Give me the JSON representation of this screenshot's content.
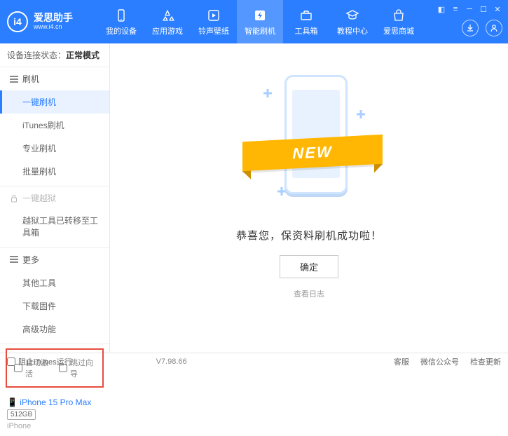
{
  "header": {
    "logo_title": "爱思助手",
    "logo_url": "www.i4.cn",
    "logo_mark": "i4",
    "nav": [
      {
        "label": "我的设备",
        "icon": "device"
      },
      {
        "label": "应用游戏",
        "icon": "apps"
      },
      {
        "label": "铃声壁纸",
        "icon": "media"
      },
      {
        "label": "智能刷机",
        "icon": "flash",
        "active": true
      },
      {
        "label": "工具箱",
        "icon": "toolbox"
      },
      {
        "label": "教程中心",
        "icon": "tutorial"
      },
      {
        "label": "爱思商城",
        "icon": "store"
      }
    ]
  },
  "sidebar": {
    "conn_label": "设备连接状态：",
    "conn_value": "正常模式",
    "sections": [
      {
        "title": "刷机",
        "type": "open",
        "items": [
          "一键刷机",
          "iTunes刷机",
          "专业刷机",
          "批量刷机"
        ],
        "active_index": 0
      },
      {
        "title": "一键越狱",
        "type": "locked",
        "items": [
          "越狱工具已转移至工具箱"
        ]
      },
      {
        "title": "更多",
        "type": "open",
        "items": [
          "其他工具",
          "下载固件",
          "高级功能"
        ]
      }
    ],
    "checkboxes": {
      "auto_activate": "自动激活",
      "skip_guide": "跳过向导"
    },
    "device": {
      "name": "iPhone 15 Pro Max",
      "storage": "512GB",
      "type": "iPhone"
    }
  },
  "main": {
    "ribbon": "NEW",
    "success_text": "恭喜您，保资料刷机成功啦！",
    "ok_button": "确定",
    "log_link": "查看日志"
  },
  "footer": {
    "block_itunes": "阻止iTunes运行",
    "version": "V7.98.66",
    "links": [
      "客服",
      "微信公众号",
      "检查更新"
    ]
  }
}
